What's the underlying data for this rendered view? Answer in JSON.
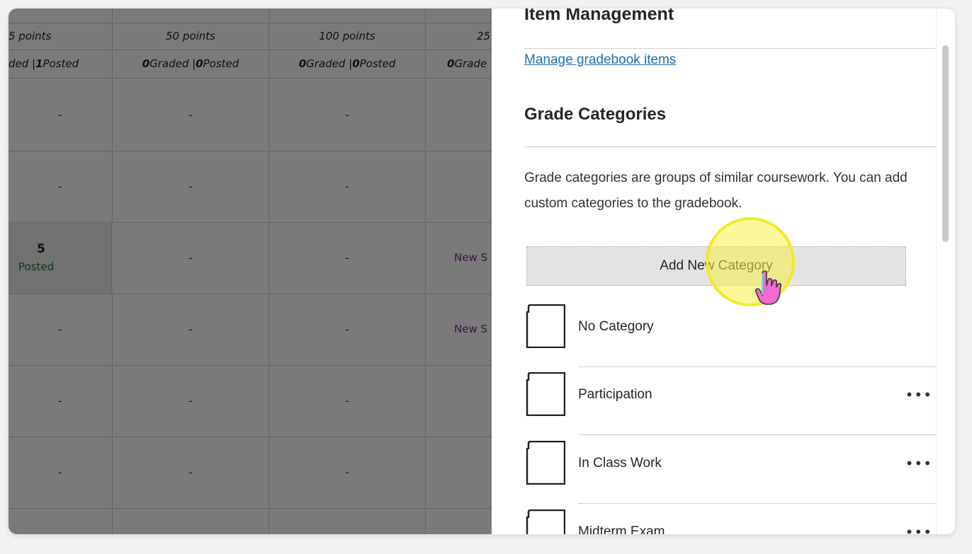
{
  "grid": {
    "points": [
      "5 points",
      "50 points",
      "100 points",
      "25"
    ],
    "status": [
      {
        "pre": "",
        "a": "",
        "mid": "ded | ",
        "b": "1",
        "post": " Posted"
      },
      {
        "pre": "",
        "a": "0",
        "mid": " Graded | ",
        "b": "0",
        "post": " Posted"
      },
      {
        "pre": "",
        "a": "0",
        "mid": " Graded | ",
        "b": "0",
        "post": " Posted"
      },
      {
        "pre": "",
        "a": "0",
        "mid": " Grade",
        "b": "",
        "post": ""
      }
    ],
    "dash": "-",
    "highlight_score": "5",
    "highlight_status": "Posted",
    "new_submission": "New S"
  },
  "panel": {
    "item_management_title": "Item Management",
    "manage_link": "Manage gradebook items",
    "grade_categories_title": "Grade Categories",
    "description": "Grade categories are groups of similar coursework. You can add custom categories to the gradebook.",
    "add_button": "Add New Category",
    "categories": [
      {
        "name": "No Category",
        "menu": ""
      },
      {
        "name": "Participation",
        "menu": "•••"
      },
      {
        "name": "In Class Work",
        "menu": "•••"
      },
      {
        "name": "Midterm Exam",
        "menu": "•••"
      }
    ]
  }
}
